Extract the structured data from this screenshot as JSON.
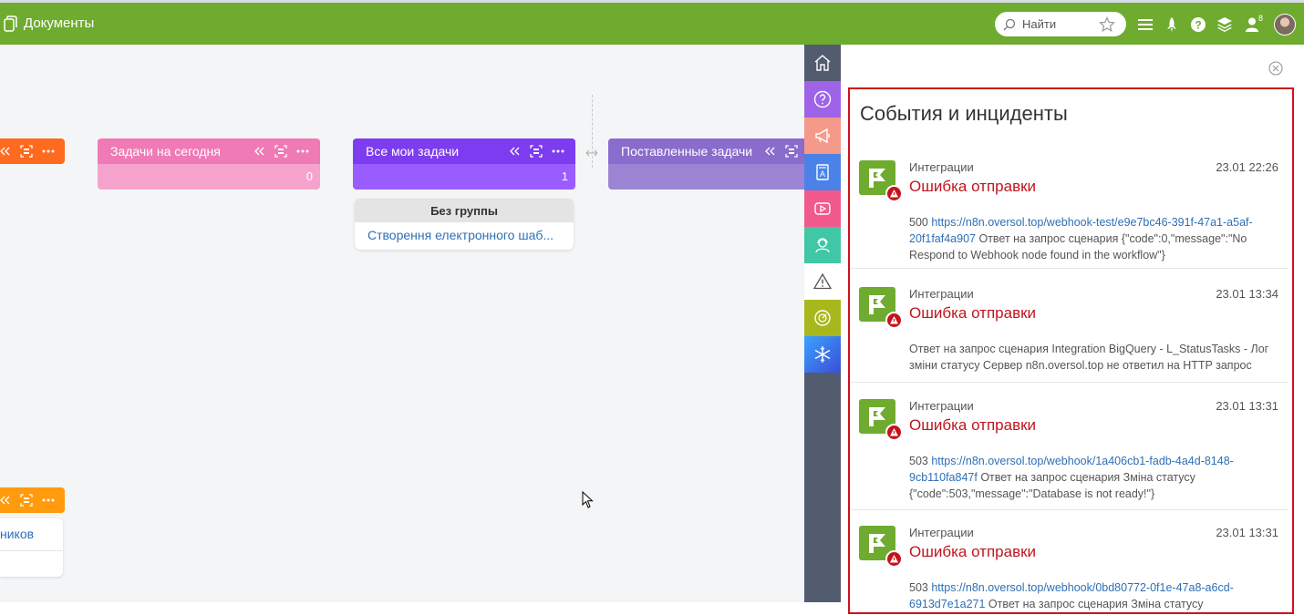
{
  "app": {
    "title": "Документы"
  },
  "search": {
    "placeholder": "Найти"
  },
  "header": {
    "notifications_count": "8"
  },
  "columns": [
    {
      "title": "Задачи на сегодня",
      "count": "0"
    },
    {
      "title": "Все мои задачи",
      "count": "1"
    },
    {
      "title": "Поставленные задачи",
      "count": ""
    }
  ],
  "task_group": {
    "group_label": "Без группы",
    "task_link": "Створення електронного шаб..."
  },
  "left_card": {
    "link_text": "ников"
  },
  "colors": {
    "topbar": "#6fab2f",
    "column_pink": "#f07ab5",
    "column_purple": "#7d3cf0",
    "column_violet": "#9b72d6",
    "column_orange": "#ff6a1f",
    "column_amber": "#ff9b0c",
    "error_red": "#c0151d",
    "link_blue": "#2f6fb5"
  },
  "rail": [
    "home-icon",
    "help-icon",
    "megaphone-icon",
    "reader-icon",
    "video-icon",
    "support-agent-icon",
    "warning-icon",
    "gauge-icon",
    "snowflake-icon"
  ],
  "panel": {
    "title": "События и инциденты",
    "events": [
      {
        "source": "Интеграции",
        "time": "23.01 22:26",
        "title": "Ошибка отправки",
        "code": "500",
        "url": "https://n8n.oversol.top/webhook-test/e9e7bc46-391f-47a1-a5af-20f1faf4a907",
        "message": "Ответ на запрос сценария {\"code\":0,\"message\":\"No Respond to Webhook node found in the workflow\"}"
      },
      {
        "source": "Интеграции",
        "time": "23.01 13:34",
        "title": "Ошибка отправки",
        "code": "",
        "url": "",
        "message": "Ответ на запрос сценария Integration BigQuery - L_StatusTasks - Лог зміни статусу Сервер n8n.oversol.top не ответил на HTTP запрос"
      },
      {
        "source": "Интеграции",
        "time": "23.01 13:31",
        "title": "Ошибка отправки",
        "code": "503",
        "url": "https://n8n.oversol.top/webhook/1a406cb1-fadb-4a4d-8148-9cb110fa847f",
        "message": "Ответ на запрос сценария Зміна статусу {\"code\":503,\"message\":\"Database is not ready!\"}"
      },
      {
        "source": "Интеграции",
        "time": "23.01 13:31",
        "title": "Ошибка отправки",
        "code": "503",
        "url": "https://n8n.oversol.top/webhook/0bd80772-0f1e-47a8-a6cd-6913d7e1a271",
        "message": "Ответ на запрос сценария Зміна статусу"
      }
    ]
  }
}
